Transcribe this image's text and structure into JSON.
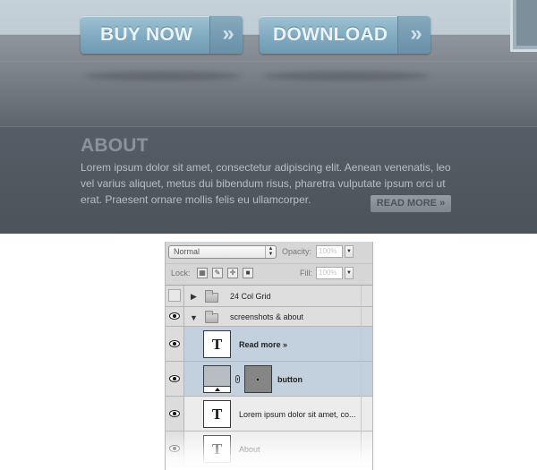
{
  "mockup": {
    "buttons": [
      {
        "label": "BUY NOW",
        "arrow": "»"
      },
      {
        "label": "DOWNLOAD",
        "arrow": "»"
      }
    ],
    "about": {
      "title": "ABOUT",
      "text": "Lorem ipsum dolor sit amet, consectetur adipiscing elit. Aenean venenatis, leo vel varius aliquet, metus dui bibendum risus, pharetra vulputate ipsum orci ut erat. Praesent ornare mollis felis eu ullamcorper.",
      "read_more": "READ MORE »"
    }
  },
  "layers_panel": {
    "blend_mode": "Normal",
    "opacity_label": "Opacity:",
    "opacity_value": "100%",
    "lock_label": "Lock:",
    "fill_label": "Fill:",
    "fill_value": "100%",
    "layers": [
      {
        "name": "24 Col Grid",
        "kind": "group",
        "visible": false,
        "expanded": false
      },
      {
        "name": "screenshots & about",
        "kind": "group",
        "visible": true,
        "expanded": true
      },
      {
        "name": "Read more »",
        "kind": "text",
        "visible": true,
        "thumb_glyph": "T"
      },
      {
        "name": "button",
        "kind": "shape",
        "visible": true
      },
      {
        "name": "Lorem ipsum dolor sit amet, co...",
        "kind": "text",
        "visible": true,
        "thumb_glyph": "T"
      },
      {
        "name": "About",
        "kind": "text",
        "visible": true,
        "thumb_glyph": "T"
      }
    ]
  },
  "icons": {
    "visibility": "eye-icon",
    "group": "folder-icon",
    "text_layer": "type-layer-icon",
    "link": "chain-link-icon"
  },
  "colors": {
    "button_blue": "#83acc2",
    "about_bg": "#4f565e",
    "selection": "#c3d0dd"
  }
}
